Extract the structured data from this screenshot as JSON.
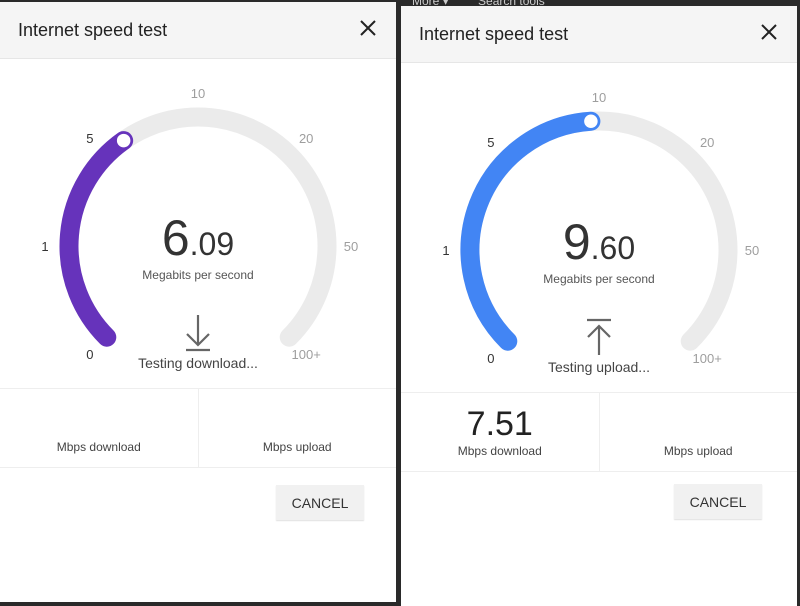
{
  "background": {
    "items": [
      "More ▾",
      "Search tools"
    ]
  },
  "tick_labels": [
    "0",
    "1",
    "5",
    "10",
    "20",
    "50",
    "100+"
  ],
  "colors": {
    "track": "#ebebeb",
    "download": "#6633bb",
    "upload": "#4285f4",
    "passed_label": "#333333",
    "future_label": "#9e9e9e"
  },
  "panels": [
    {
      "title": "Internet speed test",
      "close_icon": "close-icon",
      "speed_int": "6",
      "speed_dec": ".09",
      "speed_value": 6.09,
      "unit": "Megabits per second",
      "mode": "download",
      "status_icon": "download-arrow-icon",
      "status": "Testing download...",
      "download_value": "",
      "download_label": "Mbps download",
      "upload_value": "",
      "upload_label": "Mbps upload",
      "cancel": "CANCEL"
    },
    {
      "title": "Internet speed test",
      "close_icon": "close-icon",
      "speed_int": "9",
      "speed_dec": ".60",
      "speed_value": 9.6,
      "unit": "Megabits per second",
      "mode": "upload",
      "status_icon": "upload-arrow-icon",
      "status": "Testing upload...",
      "download_value": "7.51",
      "download_label": "Mbps download",
      "upload_value": "",
      "upload_label": "Mbps upload",
      "cancel": "CANCEL"
    }
  ]
}
